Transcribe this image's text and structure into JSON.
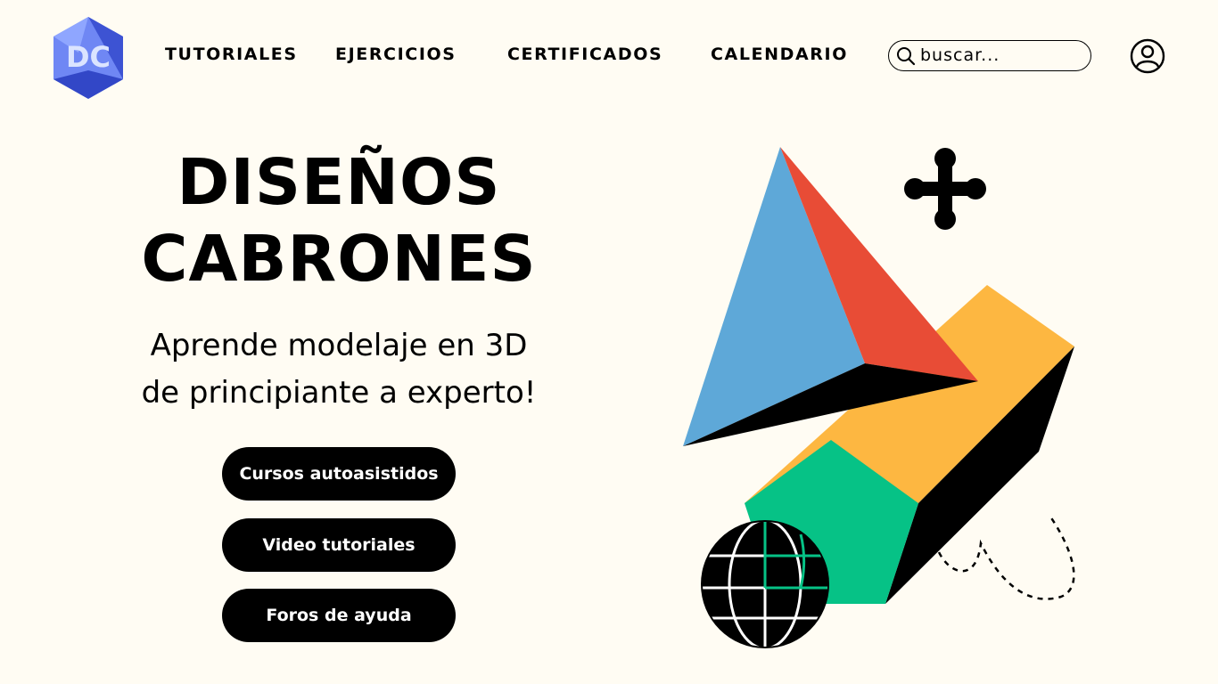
{
  "logo": {
    "text": "DC",
    "icon": "hexagon-logo",
    "color_light": "#8fa6ff",
    "color_dark": "#3247c7"
  },
  "nav": {
    "items": [
      {
        "label": "TUTORIALES"
      },
      {
        "label": "EJERCICIOS"
      },
      {
        "label": "CERTIFICADOS"
      },
      {
        "label": "CALENDARIO"
      }
    ]
  },
  "search": {
    "placeholder": "buscar...",
    "value": "",
    "icon": "search-icon"
  },
  "user": {
    "icon": "user-account-icon"
  },
  "hero": {
    "title_line1": "DISEÑOS",
    "title_line2": "CABRONES",
    "subtitle_line1": "Aprende modelaje en 3D",
    "subtitle_line2": "de principiante a experto!"
  },
  "buttons": {
    "self_paced": "Cursos autoasistidos",
    "video_tutorials": "Video tutoriales",
    "help_forums": "Foros de ayuda"
  },
  "colors": {
    "background": "#fffcf3",
    "blue": "#5ea8d8",
    "red": "#e84c36",
    "yellow": "#fdb741",
    "green": "#06c286",
    "black": "#000000"
  }
}
